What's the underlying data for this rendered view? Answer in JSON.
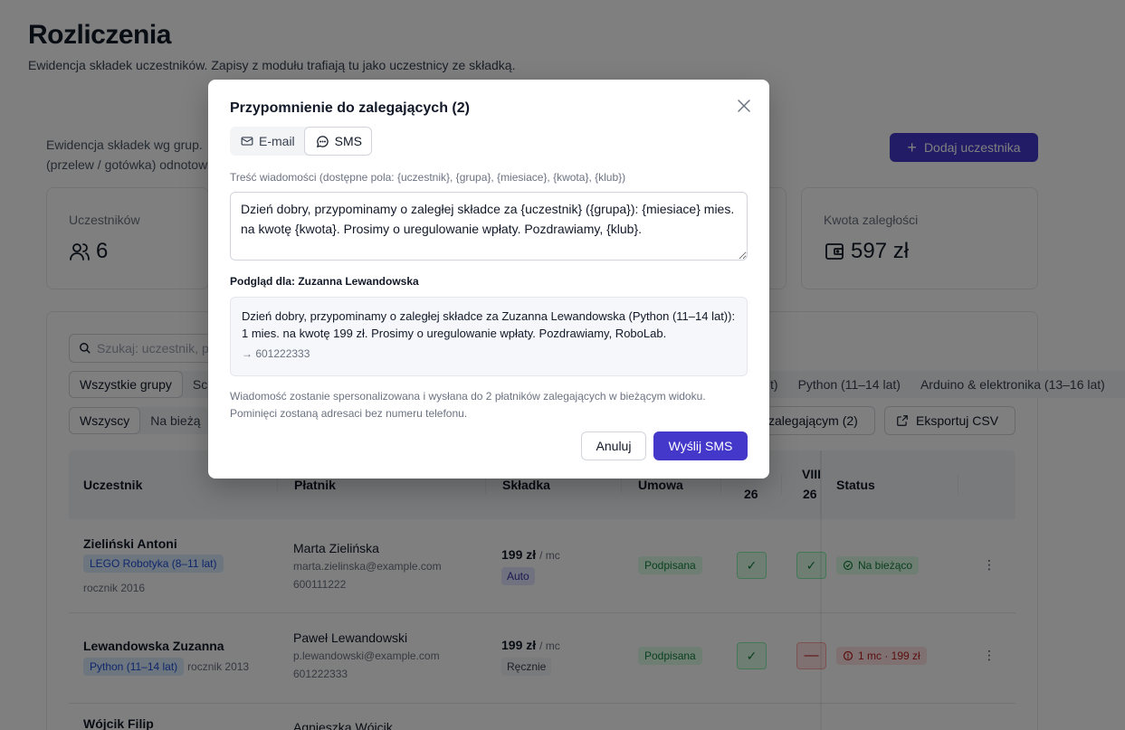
{
  "page": {
    "title": "Rozliczenia",
    "subtitle": "Ewidencja składek uczestników. Zapisy z modułu trafiają tu jako uczestnicy ze składką.",
    "info_line1": "Ewidencja składek wg grup.",
    "info_line2": "(przelew / gotówka) odnotow",
    "add_button": "Dodaj uczestnika"
  },
  "stats": {
    "participants_label": "Uczestników",
    "participants_value": "6",
    "arrears_label": "Kwota zaległości",
    "arrears_value": "597 zł"
  },
  "toolbar": {
    "search_placeholder": "Szukaj: uczestnik, p",
    "groups": [
      "Wszystkie grupy",
      "Sc"
    ],
    "groups_right": [
      "t)",
      "Python (11–14 lat)",
      "Arduino & elektronika (13–16 lat)"
    ],
    "filters": [
      "Wszyscy",
      "Na bieżą"
    ],
    "remind_button": "zalegającym (2)",
    "export_button": "Eksportuj CSV"
  },
  "table": {
    "headers": {
      "participant": "Uczestnik",
      "payer": "Płatnik",
      "fee": "Składka",
      "contract": "Umowa",
      "month1": "26",
      "month2_top": "VIII",
      "month2": "26",
      "status": "Status"
    },
    "rows": [
      {
        "name": "Zieliński Antoni",
        "group": "LEGO Robotyka (8–11 lat)",
        "year": "rocznik 2016",
        "payer": "Marta Zielińska",
        "email": "marta.zielinska@example.com",
        "phone": "600111222",
        "fee": "199 zł",
        "period": "/ mc",
        "mode": "Auto",
        "contract": "Podpisana",
        "status": "Na bieżąco"
      },
      {
        "name": "Lewandowska Zuzanna",
        "group": "Python (11–14 lat)",
        "year": "rocznik 2013",
        "payer": "Paweł Lewandowski",
        "email": "p.lewandowski@example.com",
        "phone": "601222333",
        "fee": "199 zł",
        "period": "/ mc",
        "mode": "Ręcznie",
        "contract": "Podpisana",
        "status": "1 mc · 199 zł"
      },
      {
        "name": "Wójcik Filip",
        "payer": "Agnieszka Wójcik"
      }
    ]
  },
  "modal": {
    "title": "Przypomnienie do zalegających (2)",
    "tab_email": "E-mail",
    "tab_sms": "SMS",
    "fields_hint": "Treść wiadomości (dostępne pola: {uczestnik}, {grupa}, {miesiace}, {kwota}, {klub})",
    "message": "Dzień dobry, przypominamy o zaległej składce za {uczestnik} ({grupa}): {miesiace} mies. na kwotę {kwota}. Prosimy o uregulowanie wpłaty. Pozdrawiamy, {klub}.",
    "preview_title": "Podgląd dla: Zuzanna Lewandowska",
    "preview_text": "Dzień dobry, przypominamy o zaległej składce za Zuzanna Lewandowska (Python (11–14 lat)): 1 mies. na kwotę 199 zł. Prosimy o uregulowanie wpłaty. Pozdrawiamy, RoboLab.",
    "preview_phone": "→ 601222333",
    "note": "Wiadomość zostanie spersonalizowana i wysłana do 2 płatników zalegających w bieżącym widoku. Pominięci zostaną adresaci bez numeru telefonu.",
    "cancel": "Anuluj",
    "send": "Wyślij SMS"
  },
  "colors": {
    "accent": "#4338ca",
    "success": "#15803d",
    "danger": "#b91c1c"
  }
}
